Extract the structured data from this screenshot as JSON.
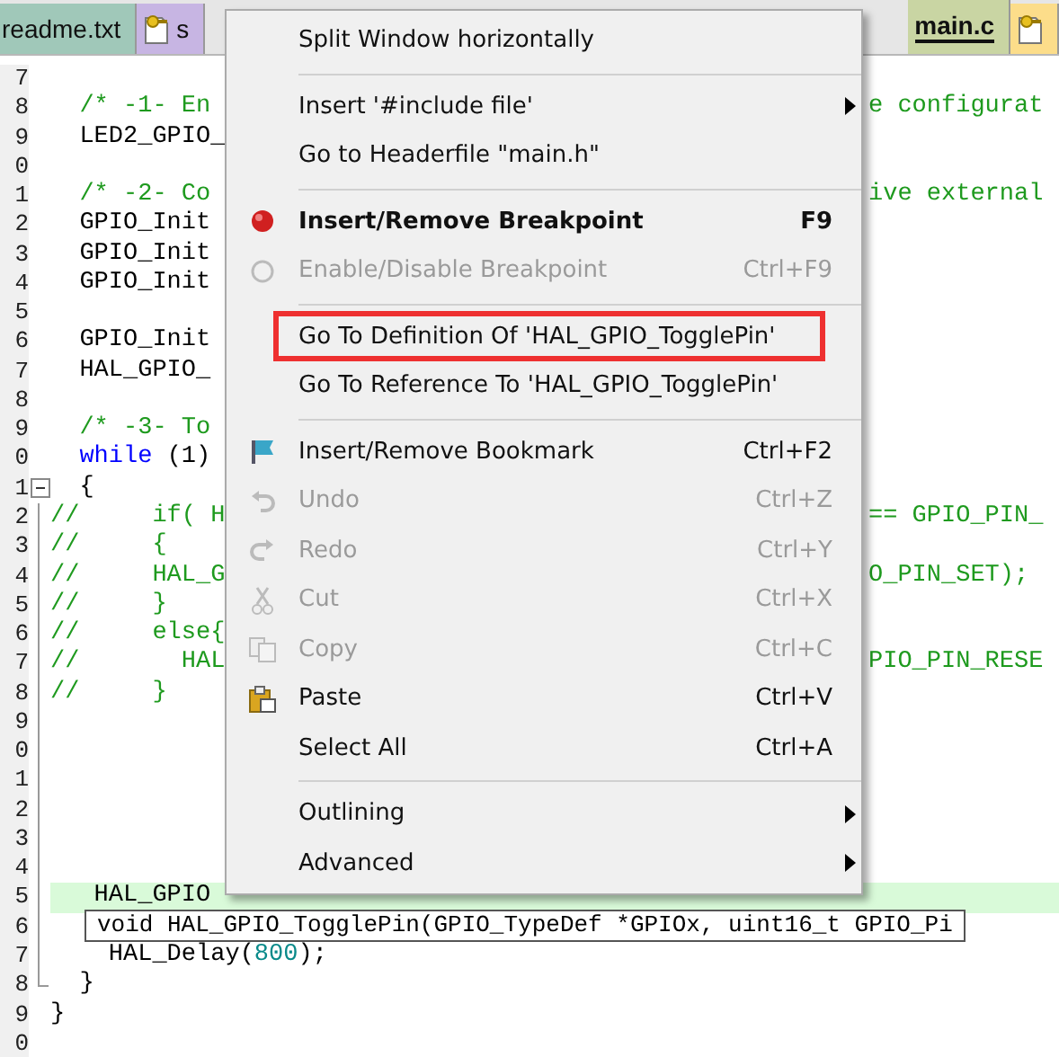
{
  "tabs": [
    {
      "label": "readme.txt",
      "selected": false,
      "color": "#a0c8b9",
      "icon": false
    },
    {
      "label": "s",
      "selected": false,
      "color": "#c7b5e3",
      "icon": true
    },
    {
      "label": "main.c",
      "selected": true,
      "color": "#c9d5a3",
      "icon": false
    },
    {
      "selected": false,
      "color": "#fcdd8a",
      "icon": true
    }
  ],
  "editor": {
    "lines": [
      {
        "number": "7"
      },
      {
        "number": "8",
        "segments": [
          {
            "kind": "comment",
            "text": "  /* -1- En"
          }
        ],
        "right": [
          {
            "kind": "comment",
            "text": "e configurat"
          }
        ]
      },
      {
        "number": "9",
        "segments": [
          {
            "kind": "plain",
            "text": "  LED2_GPIO_"
          }
        ]
      },
      {
        "number": "0"
      },
      {
        "number": "1",
        "segments": [
          {
            "kind": "comment",
            "text": "  /* -2- Co"
          }
        ],
        "right": [
          {
            "kind": "comment",
            "text": "ive external"
          }
        ]
      },
      {
        "number": "2",
        "segments": [
          {
            "kind": "plain",
            "text": "  GPIO_Init"
          }
        ]
      },
      {
        "number": "3",
        "segments": [
          {
            "kind": "plain",
            "text": "  GPIO_Init"
          }
        ]
      },
      {
        "number": "4",
        "segments": [
          {
            "kind": "plain",
            "text": "  GPIO_Init"
          }
        ]
      },
      {
        "number": "5"
      },
      {
        "number": "6",
        "segments": [
          {
            "kind": "plain",
            "text": "  GPIO_Init"
          }
        ]
      },
      {
        "number": "7",
        "segments": [
          {
            "kind": "plain",
            "text": "  HAL_GPIO_"
          }
        ]
      },
      {
        "number": "8"
      },
      {
        "number": "9",
        "segments": [
          {
            "kind": "comment",
            "text": "  /* -3- To"
          }
        ]
      },
      {
        "number": "0",
        "segments": [
          {
            "kind": "keyword",
            "text": "  while"
          },
          {
            "kind": "plain",
            "text": " (1)"
          }
        ]
      },
      {
        "number": "1",
        "kind": "foldhead",
        "segments": [
          {
            "kind": "plain",
            "text": "  {"
          }
        ]
      },
      {
        "number": "2",
        "kind": "foldbody",
        "segments": [
          {
            "kind": "comment",
            "text": "//     if( H"
          }
        ],
        "right": [
          {
            "kind": "comment",
            "text": "== GPIO_PIN_"
          }
        ]
      },
      {
        "number": "3",
        "kind": "foldbody",
        "segments": [
          {
            "kind": "comment",
            "text": "//     {"
          }
        ]
      },
      {
        "number": "4",
        "kind": "foldbody",
        "segments": [
          {
            "kind": "comment",
            "text": "//     HAL_G"
          }
        ],
        "right": [
          {
            "kind": "comment",
            "text": "O_PIN_SET);"
          }
        ]
      },
      {
        "number": "5",
        "kind": "foldbody",
        "segments": [
          {
            "kind": "comment",
            "text": "//     }"
          }
        ]
      },
      {
        "number": "6",
        "kind": "foldbody",
        "segments": [
          {
            "kind": "comment",
            "text": "//     else{"
          }
        ]
      },
      {
        "number": "7",
        "kind": "foldbody",
        "segments": [
          {
            "kind": "comment",
            "text": "//       HAL"
          }
        ],
        "right": [
          {
            "kind": "comment",
            "text": "PIO_PIN_RESE"
          }
        ]
      },
      {
        "number": "8",
        "kind": "foldbody",
        "segments": [
          {
            "kind": "comment",
            "text": "//     }"
          }
        ]
      },
      {
        "number": "9",
        "kind": "foldbody"
      },
      {
        "number": "0",
        "kind": "foldbody"
      },
      {
        "number": "1",
        "kind": "foldbody"
      },
      {
        "number": "2",
        "kind": "foldbody"
      },
      {
        "number": "3",
        "kind": "foldbody"
      },
      {
        "number": "4",
        "kind": "foldbody"
      },
      {
        "number": "5",
        "kind": "foldbody",
        "current": true,
        "segments": [
          {
            "kind": "plain",
            "text": "   HAL_GPIO"
          }
        ]
      },
      {
        "number": "6",
        "kind": "foldbody"
      },
      {
        "number": "7",
        "kind": "foldbody",
        "segments": [
          {
            "kind": "plain",
            "text": "    HAL_Delay("
          },
          {
            "kind": "number",
            "text": "800"
          },
          {
            "kind": "plain",
            "text": ");"
          }
        ]
      },
      {
        "number": "8",
        "kind": "foldtail",
        "segments": [
          {
            "kind": "plain",
            "text": "  }"
          }
        ]
      },
      {
        "number": "9",
        "segments": [
          {
            "kind": "plain",
            "text": "}"
          }
        ]
      },
      {
        "number": "0"
      }
    ],
    "tooltip": "void HAL_GPIO_TogglePin(GPIO_TypeDef *GPIOx, uint16_t GPIO_Pi"
  },
  "context_menu": {
    "items": [
      {
        "kind": "item",
        "label": "Split Window horizontally",
        "disabled": false
      },
      {
        "kind": "separator"
      },
      {
        "kind": "item",
        "label": "Insert '#include file'",
        "submenu": true,
        "disabled": false
      },
      {
        "kind": "item",
        "label": "Go to Headerfile \"main.h\"",
        "disabled": false
      },
      {
        "kind": "separator"
      },
      {
        "kind": "breakpoint",
        "label": "Insert/Remove Breakpoint",
        "shortcut": "F9",
        "bold": true,
        "disabled": false
      },
      {
        "kind": "circle",
        "label": "Enable/Disable Breakpoint",
        "shortcut": "Ctrl+F9",
        "disabled": true
      },
      {
        "kind": "separator"
      },
      {
        "kind": "item",
        "label": "Go To Definition Of 'HAL_GPIO_TogglePin'",
        "highlight": true,
        "disabled": false
      },
      {
        "kind": "item",
        "label": "Go To Reference To 'HAL_GPIO_TogglePin'",
        "disabled": false
      },
      {
        "kind": "separator"
      },
      {
        "kind": "bookmark",
        "label": "Insert/Remove Bookmark",
        "shortcut": "Ctrl+F2",
        "disabled": false
      },
      {
        "kind": "undo",
        "label": "Undo",
        "shortcut": "Ctrl+Z",
        "disabled": true
      },
      {
        "kind": "redo",
        "label": "Redo",
        "shortcut": "Ctrl+Y",
        "disabled": true
      },
      {
        "kind": "cut",
        "label": "Cut",
        "shortcut": "Ctrl+X",
        "disabled": true
      },
      {
        "kind": "copy",
        "label": "Copy",
        "shortcut": "Ctrl+C",
        "disabled": true
      },
      {
        "kind": "paste",
        "label": "Paste",
        "shortcut": "Ctrl+V",
        "disabled": false
      },
      {
        "kind": "item",
        "label": "Select All",
        "shortcut": "Ctrl+A",
        "disabled": false
      },
      {
        "kind": "separator"
      },
      {
        "kind": "item",
        "label": "Outlining",
        "submenu": true,
        "disabled": false
      },
      {
        "kind": "item",
        "label": "Advanced",
        "submenu": true,
        "disabled": false
      }
    ]
  }
}
